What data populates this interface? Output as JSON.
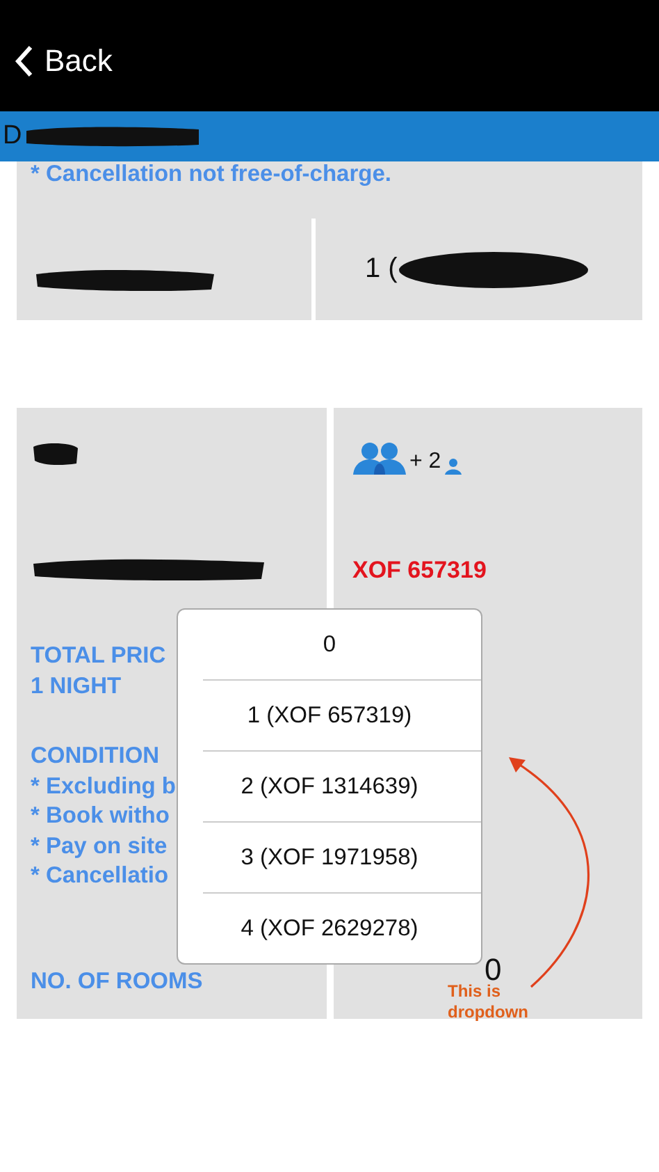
{
  "nav": {
    "back": "Back"
  },
  "header": {
    "visible_text": "D",
    "redacted": true
  },
  "summary": {
    "note": "* Cancellation not free-of-charge.",
    "label_redacted": true,
    "value": "1 (",
    "value_redacted": true
  },
  "details": [
    {
      "kind": "guests",
      "label_redacted": true,
      "extra": "+ 2"
    },
    {
      "kind": "price",
      "label_redacted": true,
      "value": "XOF 657319"
    },
    {
      "kind": "total",
      "label_lines": [
        "TOTAL PRIC",
        "1 NIGHT"
      ]
    },
    {
      "kind": "conditions",
      "label_lines": [
        "CONDITION",
        "* Excluding b",
        "* Book witho",
        "* Pay on site",
        "* Cancellatio"
      ]
    },
    {
      "kind": "rooms",
      "label_lines": [
        "NO. OF ROOMS"
      ],
      "value": "0"
    }
  ],
  "dropdown": {
    "options": [
      "0",
      "1 (XOF  657319)",
      "2 (XOF  1314639)",
      "3 (XOF  1971958)",
      "4 (XOF  2629278)"
    ]
  },
  "annotation": {
    "text": "This is dropdown"
  }
}
